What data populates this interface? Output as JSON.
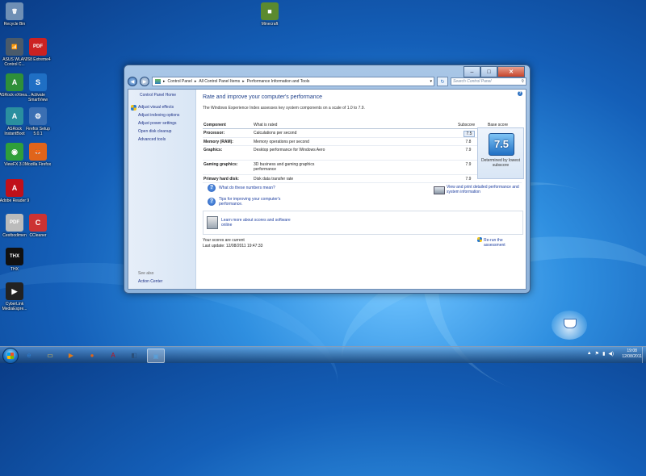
{
  "desktop": {
    "icons": [
      {
        "label": "Recycle Bin",
        "glyph": "🗑",
        "color": "#6f8fb5"
      },
      {
        "label": "ASUS WLAN Control C...",
        "glyph": "📶",
        "color": "#4a5a6a"
      },
      {
        "label": "Z68 Extreme4",
        "glyph": "PDF",
        "color": "#c22"
      },
      {
        "label": "ASRock eXtrea...",
        "glyph": "A",
        "color": "#2e8f3a"
      },
      {
        "label": "Activate SmartView",
        "glyph": "S",
        "color": "#1f6fc4"
      },
      {
        "label": "ASRock InstantBoot",
        "glyph": "A",
        "color": "#2a8f9f"
      },
      {
        "label": "Firefox Setup 5.0.1",
        "glyph": "⚙",
        "color": "#3a6fb3"
      },
      {
        "label": "ViewFX 3.0",
        "glyph": "◉",
        "color": "#2f9f3a"
      },
      {
        "label": "Mozilla Firefox",
        "glyph": "🦊",
        "color": "#e0641a"
      },
      {
        "label": "Adobe Reader 9",
        "glyph": "A",
        "color": "#c0101a"
      },
      {
        "label": "Cestbodimen",
        "glyph": "PDF",
        "color": "#bbb"
      },
      {
        "label": "CCleaner",
        "glyph": "C",
        "color": "#c33"
      },
      {
        "label": "THX",
        "glyph": "THX",
        "color": "#111"
      },
      {
        "label": "CyberLink MediaEspre...",
        "glyph": "▶",
        "color": "#222"
      },
      {
        "label": "Minecraft",
        "glyph": "■",
        "color": "#5b8a2f"
      }
    ]
  },
  "window": {
    "address": {
      "crumbs": [
        "Control Panel",
        "All Control Panel Items",
        "Performance Information and Tools"
      ],
      "search_placeholder": "Search Control Panel"
    },
    "sidebar": {
      "home": "Control Panel Home",
      "links": [
        "Adjust visual effects",
        "Adjust indexing options",
        "Adjust power settings",
        "Open disk cleanup",
        "Advanced tools"
      ],
      "see_also_label": "See also",
      "see_also": [
        "Action Center"
      ]
    },
    "main": {
      "title": "Rate and improve your computer's performance",
      "subtitle": "The Windows Experience Index assesses key system components on a scale of 1.0 to 7.9.",
      "headers": {
        "component": "Component",
        "what": "What is rated",
        "subscore": "Subscore",
        "base": "Base score"
      },
      "rows": [
        {
          "component": "Processor:",
          "what": "Calculations per second",
          "subscore": "7.5"
        },
        {
          "component": "Memory (RAM):",
          "what": "Memory operations per second",
          "subscore": "7.8"
        },
        {
          "component": "Graphics:",
          "what": "Desktop performance for Windows Aero",
          "subscore": "7.9"
        },
        {
          "component": "Gaming graphics:",
          "what": "3D business and gaming graphics performance",
          "subscore": "7.9"
        },
        {
          "component": "Primary hard disk:",
          "what": "Disk data transfer rate",
          "subscore": "7.9"
        }
      ],
      "base_score": "7.5",
      "base_desc": "Determined by lowest subscore",
      "links": {
        "numbers": "What do these numbers mean?",
        "tips": "Tips for improving your computer's performance.",
        "print": "View and print detailed performance and system information",
        "learn": "Learn more about scores and software online"
      },
      "status": {
        "current": "Your scores are current",
        "last_update": "Last update: 12/08/2011 19:47:33",
        "rerun": "Re-run the assessment"
      }
    }
  },
  "taskbar": {
    "apps": [
      {
        "name": "ie",
        "glyph": "e",
        "color": "#2a7fd4"
      },
      {
        "name": "explorer",
        "glyph": "▭",
        "color": "#e8c050"
      },
      {
        "name": "media-player",
        "glyph": "▶",
        "color": "#e07a1a"
      },
      {
        "name": "firefox",
        "glyph": "●",
        "color": "#e0641a"
      },
      {
        "name": "adobe",
        "glyph": "A",
        "color": "#c0101a"
      },
      {
        "name": "app-6",
        "glyph": "◧",
        "color": "#2a4f7a"
      },
      {
        "name": "control-panel",
        "glyph": "▣",
        "color": "#5a9fd8"
      }
    ],
    "time": "19:08",
    "date": "12/08/2011"
  }
}
